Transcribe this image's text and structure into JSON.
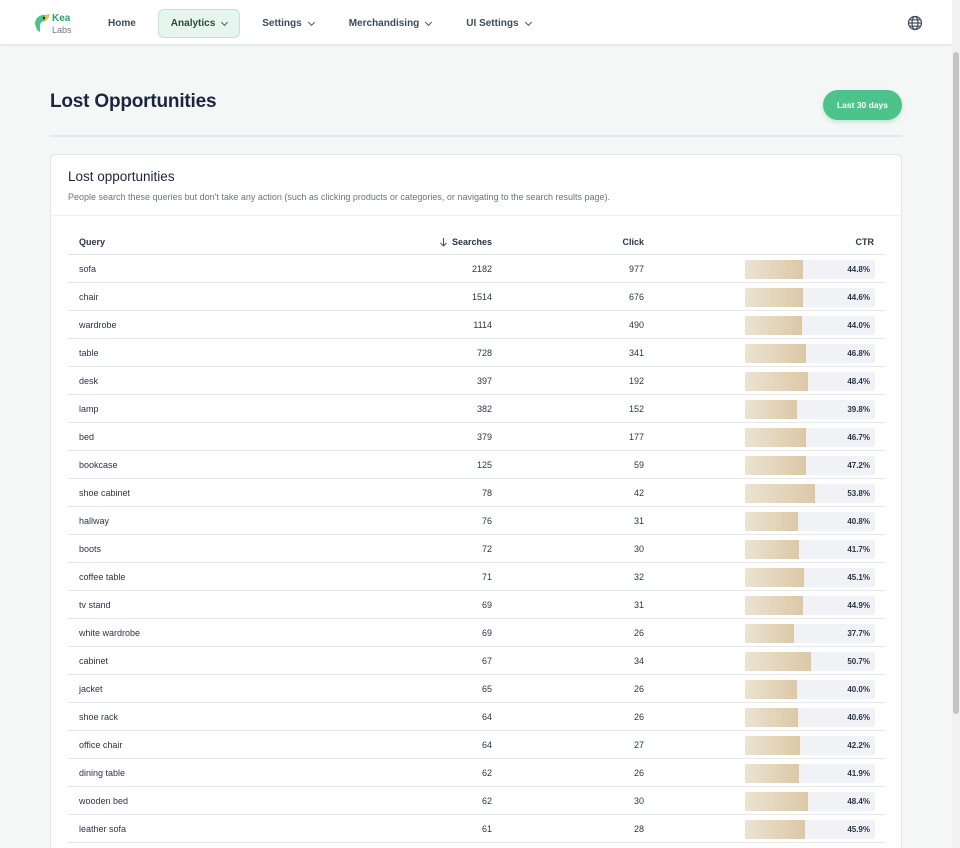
{
  "brand": {
    "line1": "Kea",
    "line2": "Labs"
  },
  "nav": [
    {
      "label": "Home",
      "dropdown": false,
      "active": false
    },
    {
      "label": "Analytics",
      "dropdown": true,
      "active": true
    },
    {
      "label": "Settings",
      "dropdown": true,
      "active": false
    },
    {
      "label": "Merchandising",
      "dropdown": true,
      "active": false
    },
    {
      "label": "UI Settings",
      "dropdown": true,
      "active": false
    }
  ],
  "page": {
    "title": "Lost Opportunities",
    "range_label": "Last 30 days"
  },
  "card": {
    "title": "Lost opportunities",
    "description": "People search these queries but don't take any action (such as clicking products or categories, or navigating to the search results page)."
  },
  "table": {
    "columns": {
      "query": "Query",
      "searches": "Searches",
      "click": "Click",
      "ctr": "CTR"
    },
    "sort": {
      "column": "searches",
      "direction": "desc"
    },
    "rows": [
      {
        "query": "sofa",
        "searches": "2182",
        "click": "977",
        "ctr": "44.8%",
        "ctr_value": 44.8
      },
      {
        "query": "chair",
        "searches": "1514",
        "click": "676",
        "ctr": "44.6%",
        "ctr_value": 44.6
      },
      {
        "query": "wardrobe",
        "searches": "1114",
        "click": "490",
        "ctr": "44.0%",
        "ctr_value": 44.0
      },
      {
        "query": "table",
        "searches": "728",
        "click": "341",
        "ctr": "46.8%",
        "ctr_value": 46.8
      },
      {
        "query": "desk",
        "searches": "397",
        "click": "192",
        "ctr": "48.4%",
        "ctr_value": 48.4
      },
      {
        "query": "lamp",
        "searches": "382",
        "click": "152",
        "ctr": "39.8%",
        "ctr_value": 39.8
      },
      {
        "query": "bed",
        "searches": "379",
        "click": "177",
        "ctr": "46.7%",
        "ctr_value": 46.7
      },
      {
        "query": "bookcase",
        "searches": "125",
        "click": "59",
        "ctr": "47.2%",
        "ctr_value": 47.2
      },
      {
        "query": "shoe cabinet",
        "searches": "78",
        "click": "42",
        "ctr": "53.8%",
        "ctr_value": 53.8
      },
      {
        "query": "hallway",
        "searches": "76",
        "click": "31",
        "ctr": "40.8%",
        "ctr_value": 40.8
      },
      {
        "query": "boots",
        "searches": "72",
        "click": "30",
        "ctr": "41.7%",
        "ctr_value": 41.7
      },
      {
        "query": "coffee table",
        "searches": "71",
        "click": "32",
        "ctr": "45.1%",
        "ctr_value": 45.1
      },
      {
        "query": "tv stand",
        "searches": "69",
        "click": "31",
        "ctr": "44.9%",
        "ctr_value": 44.9
      },
      {
        "query": "white wardrobe",
        "searches": "69",
        "click": "26",
        "ctr": "37.7%",
        "ctr_value": 37.7
      },
      {
        "query": "cabinet",
        "searches": "67",
        "click": "34",
        "ctr": "50.7%",
        "ctr_value": 50.7
      },
      {
        "query": "jacket",
        "searches": "65",
        "click": "26",
        "ctr": "40.0%",
        "ctr_value": 40.0
      },
      {
        "query": "shoe rack",
        "searches": "64",
        "click": "26",
        "ctr": "40.6%",
        "ctr_value": 40.6
      },
      {
        "query": "office chair",
        "searches": "64",
        "click": "27",
        "ctr": "42.2%",
        "ctr_value": 42.2
      },
      {
        "query": "dining table",
        "searches": "62",
        "click": "26",
        "ctr": "41.9%",
        "ctr_value": 41.9
      },
      {
        "query": "wooden bed",
        "searches": "62",
        "click": "30",
        "ctr": "48.4%",
        "ctr_value": 48.4
      },
      {
        "query": "leather sofa",
        "searches": "61",
        "click": "28",
        "ctr": "45.9%",
        "ctr_value": 45.9
      }
    ]
  },
  "colors": {
    "accent": "#4cc38a",
    "ctr_fill": "#dcc8a6",
    "ctr_track": "#f1f2f6"
  },
  "icons": {
    "logo": "kea-parrot-icon",
    "globe": "globe-icon",
    "sort": "arrow-down-icon"
  }
}
